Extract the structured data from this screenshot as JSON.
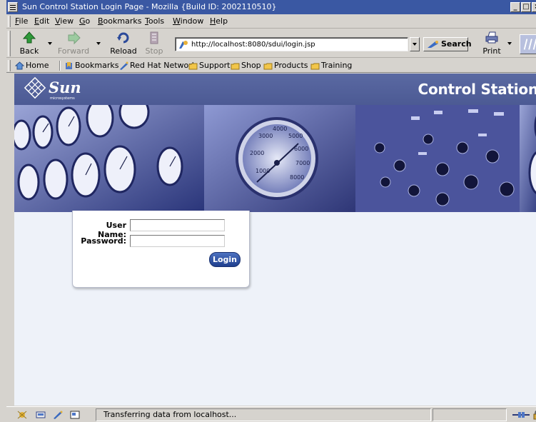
{
  "window": {
    "title": "Sun Control Station Login Page - Mozilla {Build ID: 2002110510}",
    "minimize": "_",
    "maximize": "□",
    "close": "×"
  },
  "menu": {
    "file": "File",
    "edit": "Edit",
    "view": "View",
    "go": "Go",
    "bookmarks": "Bookmarks",
    "tools": "Tools",
    "window": "Window",
    "help": "Help"
  },
  "nav": {
    "back": "Back",
    "forward": "Forward",
    "reload": "Reload",
    "stop": "Stop",
    "url": "http://localhost:8080/sdui/login.jsp",
    "search": "Search",
    "print": "Print"
  },
  "personal_toolbar": {
    "home": "Home",
    "bookmarks": "Bookmarks",
    "red_hat_network": "Red Hat Network",
    "support": "Support",
    "shop": "Shop",
    "products": "Products",
    "training": "Training"
  },
  "page": {
    "brand": "Sun",
    "brand_sub": "microsystems",
    "product_title": "Control Station",
    "gauge_labels": [
      "1000",
      "2000",
      "3000",
      "4000",
      "5000",
      "6000",
      "7000",
      "8000"
    ],
    "login": {
      "username_label": "User Name:",
      "password_label": "Password:",
      "username_value": "",
      "password_value": "",
      "button": "Login"
    }
  },
  "status": {
    "text": "Transferring data from localhost..."
  },
  "colors": {
    "titlebar": "#3a58a3",
    "masthead": "#5867a0",
    "content_bg": "#eef2f9",
    "login_button": "#2a4ea5"
  }
}
